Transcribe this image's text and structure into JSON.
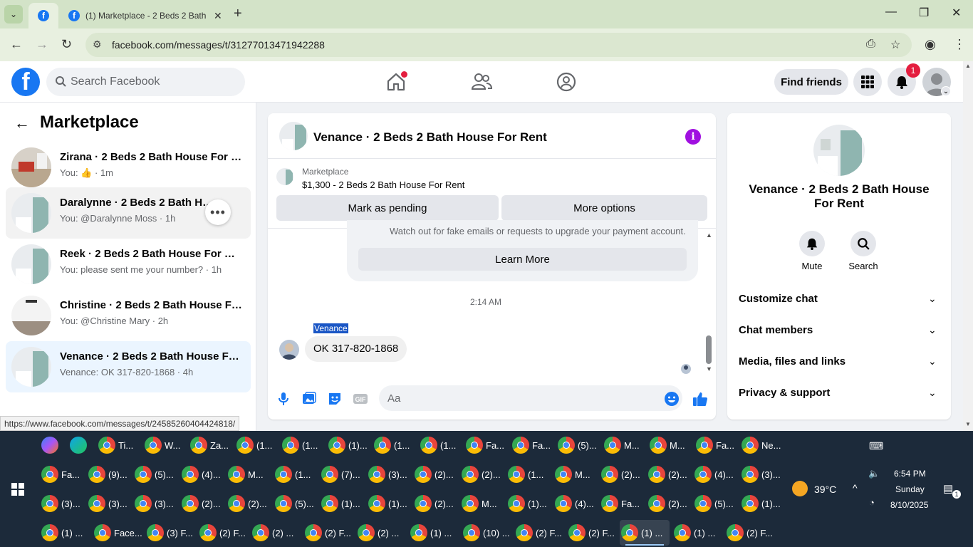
{
  "browser": {
    "tab_title": "(1) Marketplace - 2 Beds 2 Bath",
    "url": "facebook.com/messages/t/31277013471942288",
    "status_url": "https://www.facebook.com/messages/t/24585260404424818/"
  },
  "header": {
    "search_placeholder": "Search Facebook",
    "find_friends": "Find friends",
    "notif_count": "1",
    "colors": {
      "brand": "#1877f2",
      "badge": "#e41e3f"
    }
  },
  "left": {
    "title": "Marketplace",
    "conversations": [
      {
        "name": "Zirana · 2 Beds 2 Bath House For Rent",
        "sub_prefix": "You:",
        "sub": "· 1m",
        "state": "normal"
      },
      {
        "name": "Daralynne · 2 Beds 2 Bath House For Rent",
        "sub": "You: @Daralynne Moss · 1h",
        "state": "hover"
      },
      {
        "name": "Reek · 2 Beds 2 Bath House For Rent",
        "sub": "You: please sent me your number? · 1h",
        "state": "normal"
      },
      {
        "name": "Christine · 2 Beds 2 Bath House For Rent",
        "sub": "You: @Christine Mary · 2h",
        "state": "normal"
      },
      {
        "name": "Venance · 2 Beds 2 Bath House For Rent",
        "sub": "Venance: OK 317-820-1868 · 4h",
        "state": "selected"
      }
    ]
  },
  "chat": {
    "title": "Venance · 2 Beds 2 Bath House For Rent",
    "listing_label": "Marketplace",
    "listing_price": "$1,300 - 2 Beds 2 Bath House For Rent",
    "mark_pending": "Mark as pending",
    "more_options": "More options",
    "warning": "Watch out for fake emails or requests to upgrade your payment account.",
    "learn_more": "Learn More",
    "time": "2:14 AM",
    "sender": "Venance",
    "message": "OK 317-820-1868",
    "composer_placeholder": "Aa"
  },
  "right": {
    "name": "Venance · 2 Beds 2 Bath House For Rent",
    "mute": "Mute",
    "search": "Search",
    "sections": [
      "Customize chat",
      "Chat members",
      "Media, files and links",
      "Privacy & support"
    ]
  },
  "taskbar": {
    "row1": [
      "Ti...",
      "W...",
      "Za...",
      "(1...",
      "(1...",
      "(1)...",
      "(1...",
      "(1...",
      "Fa...",
      "Fa...",
      "(5)...",
      "M...",
      "M...",
      "Fa...",
      "Ne..."
    ],
    "row2": [
      "Fa...",
      "(9)...",
      "(5)...",
      "(4)...",
      "M...",
      "(1...",
      "(7)...",
      "(3)...",
      "(2)...",
      "(2)...",
      "(1...",
      "M...",
      "(2)...",
      "(2)...",
      "(4)...",
      "(3)..."
    ],
    "row3": [
      "(3)...",
      "(3)...",
      "(3)...",
      "(2)...",
      "(2)...",
      "(5)...",
      "(1)...",
      "(1)...",
      "(2)...",
      "M...",
      "(1)...",
      "(4)...",
      "Fa...",
      "(2)...",
      "(5)...",
      "(1)..."
    ],
    "row4": [
      "(1) ...",
      "Face...",
      "(3) F...",
      "(2) F...",
      "(2) ...",
      "(2) F...",
      "(2) ...",
      "(1) ...",
      "(10) ...",
      "(2) F...",
      "(2) F...",
      "(1) ...",
      "(1) ...",
      "(2) F..."
    ],
    "temperature": "39°C",
    "time": "6:54 PM",
    "day": "Sunday",
    "date": "8/10/2025",
    "notif": "1"
  }
}
